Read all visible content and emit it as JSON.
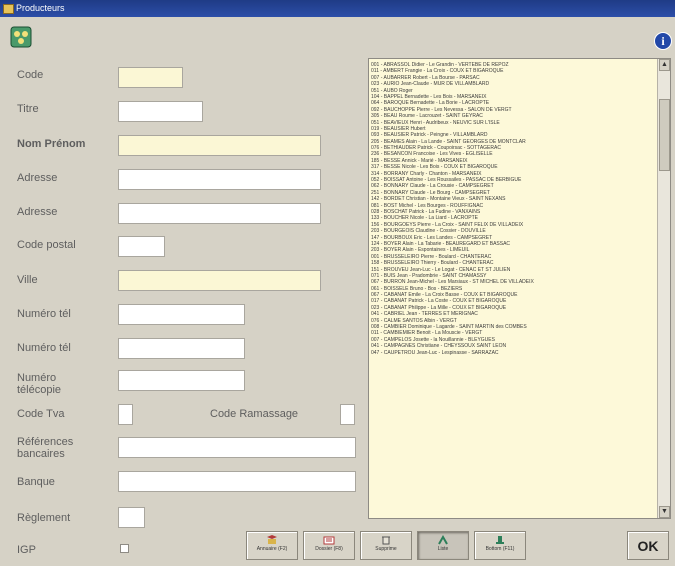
{
  "window": {
    "title": "Producteurs"
  },
  "form": {
    "code": "Code",
    "titre": "Titre",
    "nom_prenom": "Nom Prénom",
    "adresse1": "Adresse",
    "adresse2": "Adresse",
    "code_postal": "Code postal",
    "ville": "Ville",
    "numero_tel1": "Numéro tél",
    "numero_tel2": "Numéro tél",
    "numero_telecopie": "Numéro télécopie",
    "code_tva": "Code Tva",
    "code_ramassage": "Code Ramassage",
    "references_bancaires": "Références bancaires",
    "banque": "Banque",
    "reglement": "Règlement",
    "igp": "IGP"
  },
  "list": {
    "rows": [
      "001 - ABRASSOL Didier - Le Grandin - VERTEBE DE REPOZ",
      "011 - AMBERT Frangie - La Croix - COUX ET BIGAROQUE",
      "007 - AUBARRER Robert - La Bourse - PARSAC",
      "023 - AURIO Jean-Claude - MUR DE VILLAMBLARD",
      "051 - AUBO Roger",
      "104 - BAPPEL Bernadette - Les Bois - MARSANEIX",
      "064 - BAROQUE Bernadette - La Borie - LACROPTE",
      "092 - BAUCHOPPE Pierre - Les Nevessa - SALON DE VERGT",
      "305 - BEAU Roume - Lacrouzet - SAINT GEYRAC",
      "051 - BEAVIEUX Henri - Audribeux - NEUVIC SUR L'ISLE",
      "019 - BEAUSIER Hubert",
      "093 - BEAUSIER Patrick - Peingne - VILLAMBLARD",
      "205 - BEAMES Alain - La Lande - SAINT GEORGES DE MONTCLAR",
      "076 - BETHIAUDER Patrick - Coupoirsac - SOTTAGERAC",
      "236 - BESANCON Francoise - Les Vives - EGLISELLE",
      "185 - BESSE Annick - Marié - MARSANEIX",
      "317 - BESSE Nicole - Les Bois - COUX ET BIGAROQUE",
      "314 - BORRANY Charly - Chanton - MARSANEIX",
      "052 - BOISSAT Antoine - Les Roussailes - PASSAC DE BERBIGUE",
      "062 - BONNARY Claude - La Crousie - CAMPSEGRET",
      "251 - BONNARY Claude - Le Bourg - CAMPSEGRET",
      "142 - BORDET Christian - Montaine Vieux - SAINT NEXANS",
      "081 - BOST Michel - Les Bourges - ROUFFIGNAC",
      "028 - BOSCHAT Patrick - La Fudine - VANXAINS",
      "133 - BOUCHER Nicole - La Liard - LACROPTE",
      "156 - BOURGOEYS Pierre - La Croix - SAINT FELIX DE VILLADEIX",
      "203 - BOURGEOIS Claudine - Cossier - DOUVILLE",
      "147 - BOURBOUX Eric - Les Landes - CAMPSEGRET",
      "124 - BOYER Alain - La Tabarie - BEAUREGARD ET BASSAC",
      "203 - BOYER Alain - Espontaines - LIMEUIL",
      "001 - BRUSSELEIRO Pierre - Boulard - CHANTERAC",
      "158 - BRUSSELEIRO Thierry - Boulard - CHANTERAC",
      "151 - BROUVEU Jean-Luc - Le Logat - CENAC ET ST JULIEN",
      "071 - BUIS Jean - Pradombrie - SAINT CHAMASSY",
      "067 - BURRON Jean-Michel - Les Marsiaux - ST MICHEL DE VILLADEIX",
      "061 - BOISSELE Bruno - Bos - BEZIERS",
      "067 - CABANAT Emile - La Croix Basse - COUX ET BIGAROQUE",
      "017 - CABANAT Patrick - La Coste - COUX ET BIGAROQUE",
      "023 - CABANAT Philippe - La Mille - COUX ET BIGAROQUE",
      "041 - CABRIEL Jean - TERRES ET MERIGNAC",
      "076 - CALME SANTOS Albin - VERGT",
      "008 - CAMBIER Dominique - Lagarde - SAINT MARTIN des COMBES",
      "011 - CAMBIEMIER Benoit - La Mouscie - VERGT",
      "007 - CAMPELOS Josette - la Nouillannie - BLEYGUES",
      "041 - CAMPAGNES Christiane - CHEYSSOUX SAINT LEON",
      "047 - CAUPETROU Jean-Luc - Lespinasse - SARRAZAC"
    ]
  },
  "buttons": {
    "annuaire": "Annuaire (F2)",
    "dossier": "Dossier (F8)",
    "supprime": "Supprime",
    "liste": "Liste",
    "bottomsp": "Bottom (F11)",
    "ok": "OK"
  },
  "icons": {
    "info": "i"
  },
  "colors": {
    "titlebar": "#1f3b86",
    "required_field": "#fbf7d5",
    "list_bg": "#fdf9d9"
  }
}
